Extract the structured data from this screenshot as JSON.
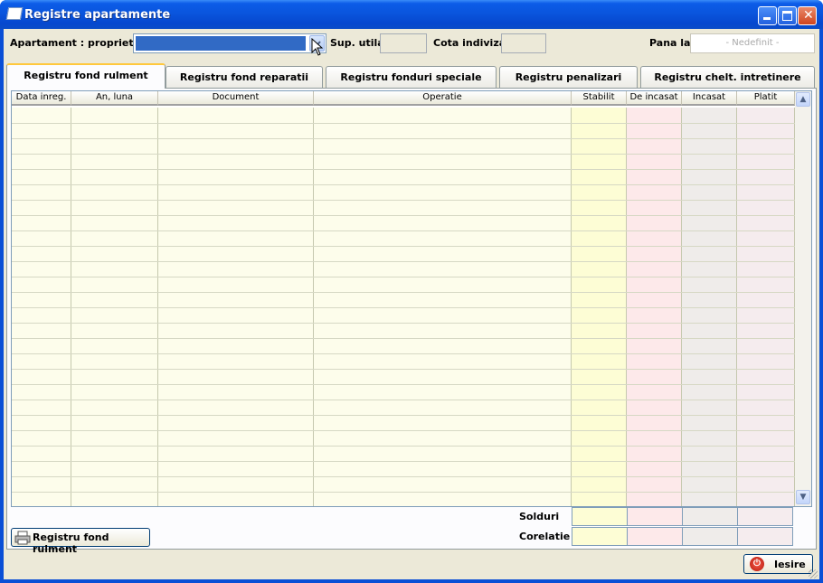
{
  "window": {
    "title": "Registre apartamente"
  },
  "header": {
    "apartament_label": "Apartament : proprietar",
    "apartament_value": "",
    "sup_utila_label": "Sup. utila",
    "sup_utila_value": "",
    "cota_indiviza_label": "Cota indiviza",
    "cota_indiviza_value": "",
    "pana_la_label": "Pana la",
    "pana_la_value": "- Nedefinit -"
  },
  "tabs": [
    {
      "label": "Registru fond rulment",
      "active": true
    },
    {
      "label": "Registru fond reparatii",
      "active": false
    },
    {
      "label": "Registru fonduri speciale",
      "active": false
    },
    {
      "label": "Registru penalizari",
      "active": false
    },
    {
      "label": "Registru chelt. intretinere",
      "active": false
    }
  ],
  "grid": {
    "columns": [
      "Data inreg.",
      "An, luna",
      "Document",
      "Operatie",
      "Stabilit",
      "De incasat",
      "Incasat",
      "Platit"
    ],
    "rows": [],
    "column_colors": [
      "#fdfdeb",
      "#fdfdeb",
      "#fdfdeb",
      "#fdfdeb",
      "#fdfdd5",
      "#fde9ea",
      "#efecea",
      "#f5ecee"
    ]
  },
  "totals": {
    "solduri_label": "Solduri",
    "corelatie_label": "Corelatie"
  },
  "buttons": {
    "print_label": "Registru fond rulment",
    "exit_label": "Iesire"
  }
}
